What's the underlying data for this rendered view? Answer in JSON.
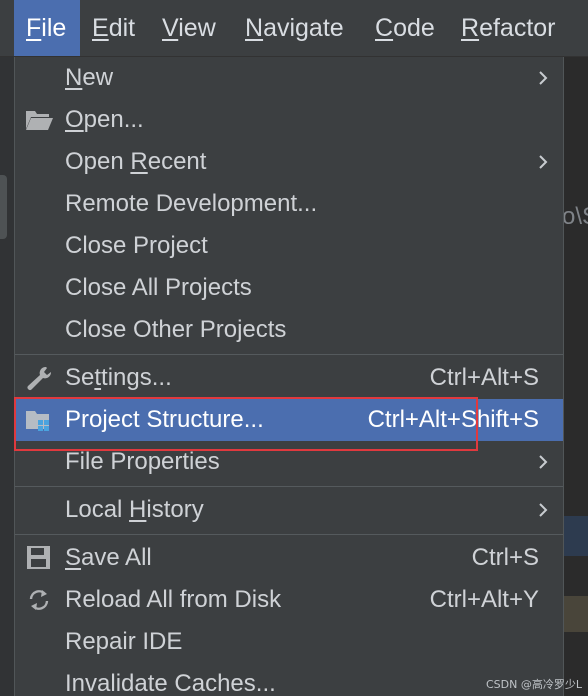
{
  "menubar": {
    "items": [
      {
        "label": "File",
        "mnemonic": "F",
        "rest": "ile",
        "active": true
      },
      {
        "label": "Edit",
        "mnemonic": "E",
        "rest": "dit",
        "active": false
      },
      {
        "label": "View",
        "mnemonic": "V",
        "rest": "iew",
        "active": false
      },
      {
        "label": "Navigate",
        "mnemonic": "N",
        "rest": "avigate",
        "active": false
      },
      {
        "label": "Code",
        "mnemonic": "C",
        "rest": "ode",
        "active": false
      },
      {
        "label": "Refactor",
        "mnemonic": "R",
        "rest": "efactor",
        "active": false
      }
    ]
  },
  "file_menu": {
    "items": [
      {
        "id": "new",
        "pre": "",
        "mnem": "N",
        "post": "ew",
        "shortcut": "",
        "submenu": true,
        "icon": ""
      },
      {
        "id": "open",
        "pre": "",
        "mnem": "O",
        "post": "pen...",
        "shortcut": "",
        "submenu": false,
        "icon": "folder-open-icon"
      },
      {
        "id": "open-recent",
        "pre": "Open ",
        "mnem": "R",
        "post": "ecent",
        "shortcut": "",
        "submenu": true,
        "icon": ""
      },
      {
        "id": "remote-development",
        "pre": "Remote Development...",
        "mnem": "",
        "post": "",
        "shortcut": "",
        "submenu": false,
        "icon": ""
      },
      {
        "id": "close-project",
        "pre": "Close Pro",
        "mnem": "j",
        "post": "ect",
        "shortcut": "",
        "submenu": false,
        "icon": ""
      },
      {
        "id": "close-all-projects",
        "pre": "Close All Projects",
        "mnem": "",
        "post": "",
        "shortcut": "",
        "submenu": false,
        "icon": ""
      },
      {
        "id": "close-other-projects",
        "pre": "Close Other Projects",
        "mnem": "",
        "post": "",
        "shortcut": "",
        "submenu": false,
        "icon": ""
      },
      {
        "id": "settings",
        "pre": "Se",
        "mnem": "t",
        "post": "tings...",
        "shortcut": "Ctrl+Alt+S",
        "submenu": false,
        "icon": "wrench-icon"
      },
      {
        "id": "project-structure",
        "pre": "Project Structure...",
        "mnem": "",
        "post": "",
        "shortcut": "Ctrl+Alt+Shift+S",
        "submenu": false,
        "icon": "project-structure-icon",
        "selected": true
      },
      {
        "id": "file-properties",
        "pre": "File Properties",
        "mnem": "",
        "post": "",
        "shortcut": "",
        "submenu": true,
        "icon": ""
      },
      {
        "id": "local-history",
        "pre": "Local ",
        "mnem": "H",
        "post": "istory",
        "shortcut": "",
        "submenu": true,
        "icon": ""
      },
      {
        "id": "save-all",
        "pre": "",
        "mnem": "S",
        "post": "ave All",
        "shortcut": "Ctrl+S",
        "submenu": false,
        "icon": "save-icon"
      },
      {
        "id": "reload-all-from-disk",
        "pre": "Reload All from Disk",
        "mnem": "",
        "post": "",
        "shortcut": "Ctrl+Alt+Y",
        "submenu": false,
        "icon": "reload-icon"
      },
      {
        "id": "repair-ide",
        "pre": "Repair IDE",
        "mnem": "",
        "post": "",
        "shortcut": "",
        "submenu": false,
        "icon": ""
      },
      {
        "id": "invalidate-caches",
        "pre": "Invalidate Caches...",
        "mnem": "",
        "post": "",
        "shortcut": "",
        "submenu": false,
        "icon": ""
      }
    ]
  },
  "background": {
    "path_fragment": "o\\S"
  },
  "watermark": "CSDN @高冷罗少L",
  "colors": {
    "menu_bg": "#3c3f41",
    "selection": "#4b6eaf",
    "highlight_box": "#e0393e",
    "text": "#cfd2d6"
  }
}
